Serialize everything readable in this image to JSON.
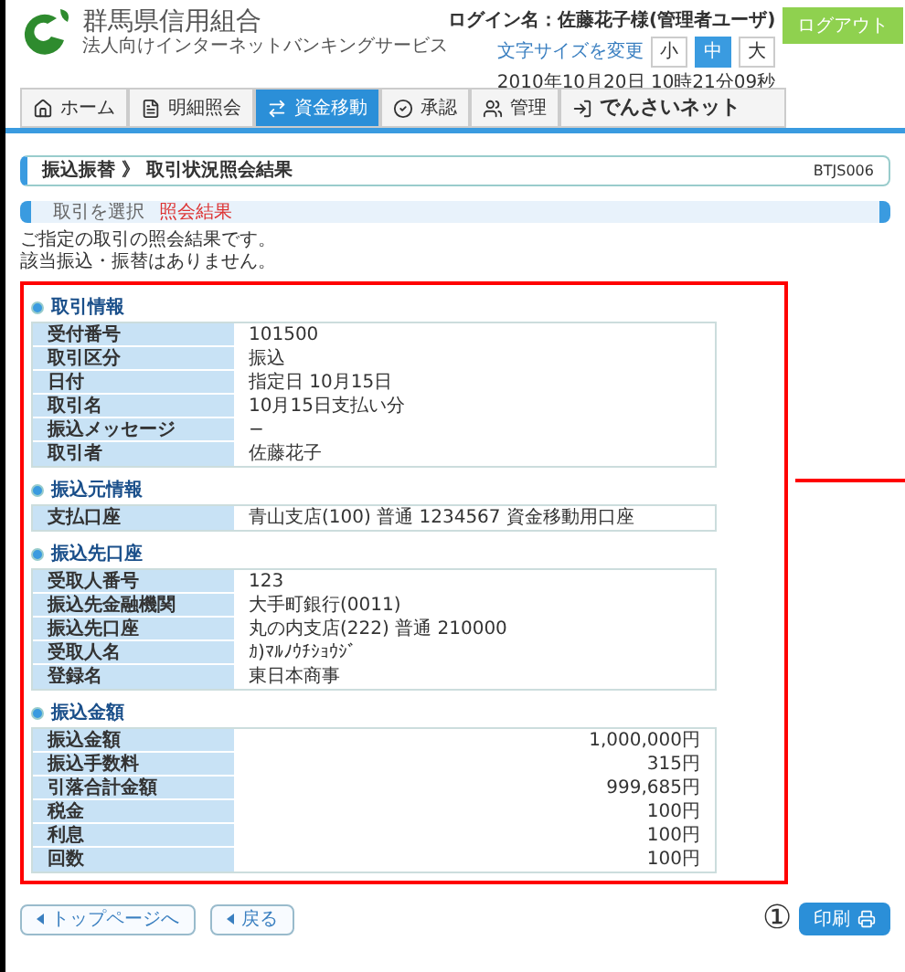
{
  "header": {
    "logo_name": "群馬県信用組合",
    "logo_subtitle": "法人向けインターネットバンキングサービス",
    "login_label": "ログイン名：",
    "login_user": "佐藤花子様(管理者ユーザ)",
    "logout": "ログアウト",
    "font_size_label": "文字サイズを変更",
    "font_sizes": [
      {
        "label": "小",
        "selected": false
      },
      {
        "label": "中",
        "selected": true
      },
      {
        "label": "大",
        "selected": false
      }
    ],
    "datetime": "2010年10月20日 10時21分09秒"
  },
  "tabs": [
    {
      "label": "ホーム",
      "selected": false
    },
    {
      "label": "明細照会",
      "selected": false
    },
    {
      "label": "資金移動",
      "selected": true
    },
    {
      "label": "承認",
      "selected": false
    },
    {
      "label": "管理",
      "selected": false
    },
    {
      "label": "でんさいネット",
      "selected": false
    }
  ],
  "page_title": {
    "title": "振込振替 》 取引状況照会結果",
    "code": "BTJS006"
  },
  "steps": [
    {
      "label": "取引を選択",
      "selected": false
    },
    {
      "label": "照会結果",
      "selected": true
    }
  ],
  "description": [
    "ご指定の取引の照会結果です。",
    "該当振込・振替はありません。"
  ],
  "sections": [
    {
      "title": "取引情報",
      "kind": "info",
      "rows": [
        {
          "label": "受付番号",
          "value": "101500"
        },
        {
          "label": "取引区分",
          "value": "振込"
        },
        {
          "label": "日付",
          "value": "指定日 10月15日"
        },
        {
          "label": "取引名",
          "value": "10月15日支払い分"
        },
        {
          "label": "振込メッセージ",
          "value": "−"
        },
        {
          "label": "取引者",
          "value": "佐藤花子"
        }
      ]
    },
    {
      "title": "振込元情報",
      "kind": "info",
      "rows": [
        {
          "label": "支払口座",
          "value": "青山支店(100) 普通 1234567 資金移動用口座"
        }
      ]
    },
    {
      "title": "振込先口座",
      "kind": "info",
      "rows": [
        {
          "label": "受取人番号",
          "value": "123"
        },
        {
          "label": "振込先金融機関",
          "value": "大手町銀行(0011)"
        },
        {
          "label": "振込先口座",
          "value": "丸の内支店(222) 普通 210000"
        },
        {
          "label": "受取人名",
          "value": "ｶ)ﾏﾙﾉｳﾁｼｮｳｼﾞ"
        },
        {
          "label": "登録名",
          "value": "東日本商事"
        }
      ]
    },
    {
      "title": "振込金額",
      "kind": "amount",
      "rows": [
        {
          "label": "振込金額",
          "value": "1,000,000円"
        },
        {
          "label": "振込手数料",
          "value": "315円"
        },
        {
          "label": "引落合計金額",
          "value": "999,685円"
        },
        {
          "label": "税金",
          "value": "100円"
        },
        {
          "label": "利息",
          "value": "100円"
        },
        {
          "label": "回数",
          "value": "100円"
        }
      ]
    }
  ],
  "buttons": [
    {
      "label": "トップページへ"
    },
    {
      "label": "戻る"
    }
  ],
  "print_button": "印刷",
  "annotation": {
    "marker": "①"
  }
}
